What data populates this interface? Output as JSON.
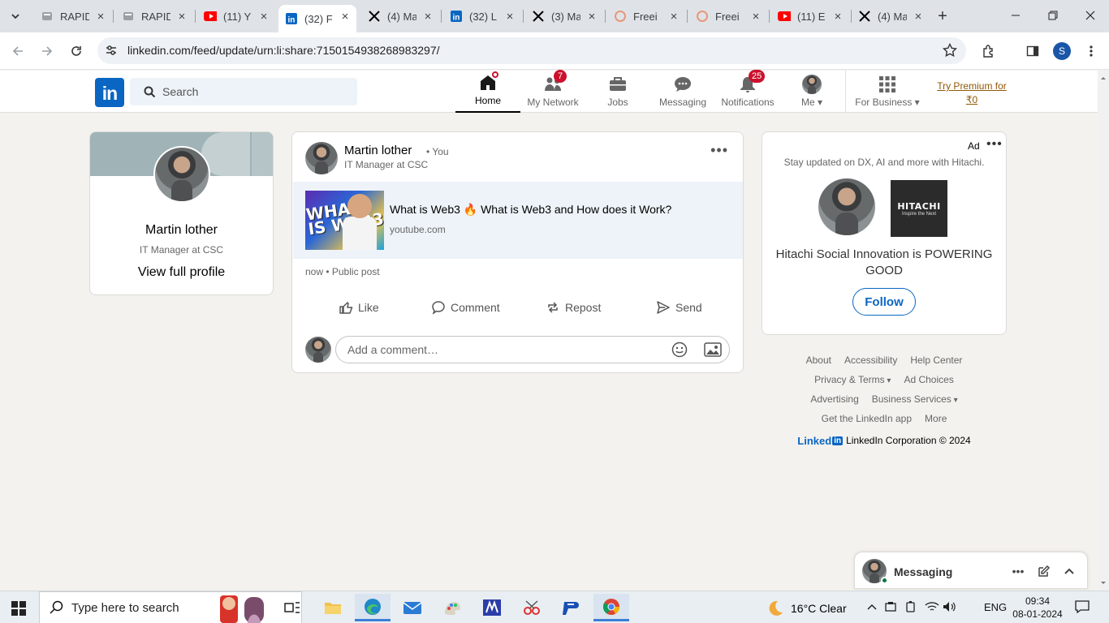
{
  "browser": {
    "tabs": [
      {
        "label": "RAPID",
        "icon": "rapid-icon"
      },
      {
        "label": "RAPID",
        "icon": "rapid-icon"
      },
      {
        "label": "(11) Y",
        "icon": "youtube-icon"
      },
      {
        "label": "(32) F",
        "icon": "linkedin-icon",
        "active": true
      },
      {
        "label": "(4) Ma",
        "icon": "x-icon"
      },
      {
        "label": "(32) L",
        "icon": "linkedin-icon"
      },
      {
        "label": "(3) Ma",
        "icon": "x-icon"
      },
      {
        "label": "Freei",
        "icon": "freepik-icon"
      },
      {
        "label": "Freei",
        "icon": "freepik-icon"
      },
      {
        "label": "(11) E",
        "icon": "youtube-icon"
      },
      {
        "label": "(4) Ma",
        "icon": "x-icon"
      }
    ],
    "url": "linkedin.com/feed/update/urn:li:share:7150154938268983297/",
    "profile_initial": "S"
  },
  "linkedin": {
    "logo": "in",
    "search_placeholder": "Search",
    "nav": {
      "home": "Home",
      "network": "My Network",
      "network_badge": "7",
      "jobs": "Jobs",
      "messaging": "Messaging",
      "notifications": "Notifications",
      "notifications_badge": "25",
      "me": "Me",
      "business": "For Business",
      "premium": "Try Premium for ₹0"
    },
    "profile": {
      "name": "Martin lother",
      "title": "IT Manager at CSC",
      "link": "View full profile"
    },
    "post": {
      "author": "Martin lother",
      "you": "• You",
      "subtitle": "IT Manager at CSC",
      "link_title": "What is Web3 🔥 What is Web3 and How does it Work?",
      "link_domain": "youtube.com",
      "thumb_text": "WHAT IS WEB3",
      "meta": "now • Public post",
      "actions": {
        "like": "Like",
        "comment": "Comment",
        "repost": "Repost",
        "send": "Send"
      },
      "comment_placeholder": "Add a comment…"
    },
    "ad": {
      "label": "Ad",
      "tagline": "Stay updated on DX, AI and more with Hitachi.",
      "logo_text": "HITACHI",
      "logo_sub": "Inspire the Next",
      "headline": "Hitachi Social Innovation is POWERING GOOD",
      "follow": "Follow"
    },
    "footer": {
      "row1": [
        "About",
        "Accessibility",
        "Help Center"
      ],
      "row2": [
        "Privacy & Terms",
        "Ad Choices"
      ],
      "row3": [
        "Advertising",
        "Business Services"
      ],
      "row4": [
        "Get the LinkedIn app",
        "More"
      ],
      "brand": "Linked",
      "brand_in": "in",
      "copyright": "LinkedIn Corporation © 2024"
    },
    "messaging": {
      "title": "Messaging"
    }
  },
  "taskbar": {
    "search_placeholder": "Type here to search",
    "weather": "16°C  Clear",
    "language": "ENG",
    "time": "09:34",
    "date": "08-01-2024"
  },
  "colors": {
    "linkedin_blue": "#0a66c2",
    "badge_red": "#cb112d",
    "premium_gold": "#915907"
  }
}
